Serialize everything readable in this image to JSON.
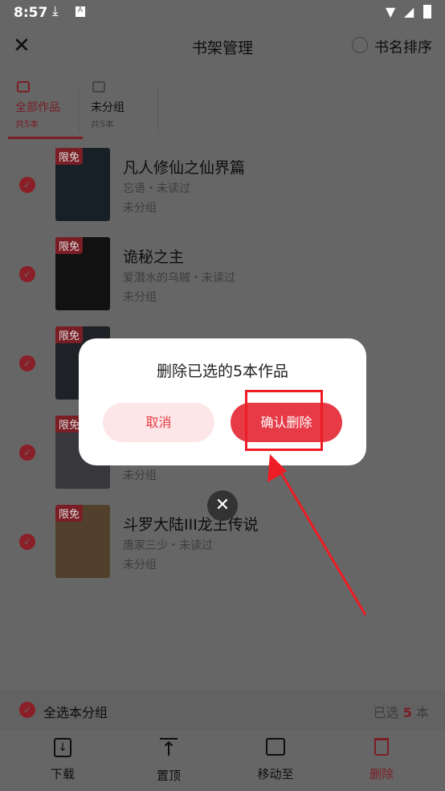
{
  "status_bar": {
    "time": "8:57"
  },
  "header": {
    "title": "书架管理",
    "sort_label": "书名排序"
  },
  "tabs": [
    {
      "label": "全部作品",
      "count": "共5本",
      "active": true
    },
    {
      "label": "未分组",
      "count": "共5本",
      "active": false
    }
  ],
  "books": [
    {
      "title": "凡人修仙之仙界篇",
      "meta": "忘语・未读过",
      "group": "未分组",
      "badge": "限免",
      "checked": true
    },
    {
      "title": "诡秘之主",
      "meta": "爱潜水的乌贼・未读过",
      "group": "未分组",
      "badge": "限免",
      "checked": true
    },
    {
      "title": "",
      "meta": "",
      "group": "",
      "badge": "限免",
      "checked": true
    },
    {
      "title": "",
      "meta": "",
      "group": "未分组",
      "badge": "限免",
      "checked": true
    },
    {
      "title": "斗罗大陆III龙王传说",
      "meta": "唐家三少・未读过",
      "group": "未分组",
      "badge": "限免",
      "checked": true
    }
  ],
  "footer": {
    "select_all": "全选本分组",
    "selected_prefix": "已选",
    "selected_count": "5",
    "selected_suffix": "本"
  },
  "toolbar": [
    {
      "label": "下载",
      "icon": "download-icon"
    },
    {
      "label": "置顶",
      "icon": "pin-top-icon"
    },
    {
      "label": "移动至",
      "icon": "folder-icon"
    },
    {
      "label": "删除",
      "icon": "trash-icon"
    }
  ],
  "dialog": {
    "title": "删除已选的5本作品",
    "cancel": "取消",
    "confirm": "确认删除"
  },
  "colors": {
    "accent": "#e63a46",
    "annotation": "#ee1c25"
  }
}
